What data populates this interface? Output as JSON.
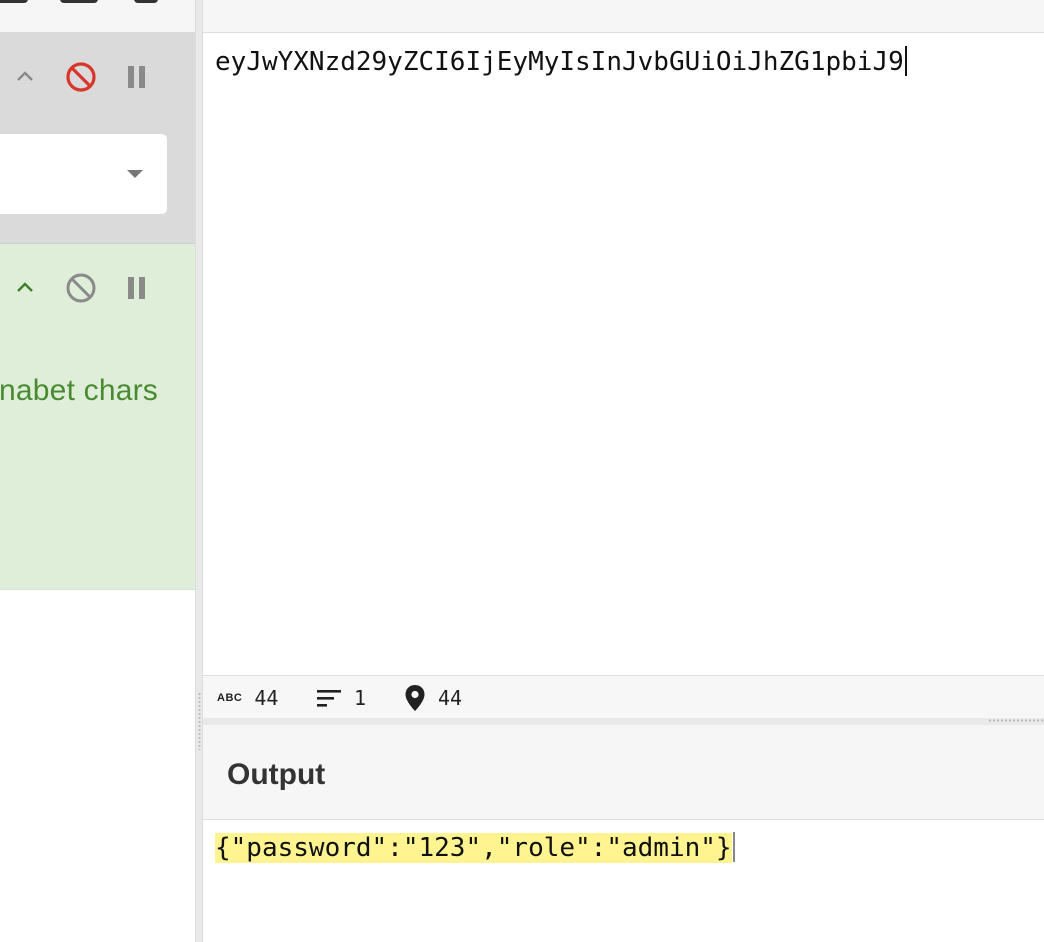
{
  "recipe": {
    "op_disabled": {
      "icons": [
        "chevron-up-icon",
        "disable-icon",
        "pause-icon"
      ],
      "disable_color": "#d9362b"
    },
    "op_active": {
      "icons": [
        "chevron-up-icon",
        "disable-icon",
        "pause-icon"
      ],
      "label_fragment": "nabet chars",
      "accent": "#4a8a32"
    }
  },
  "input": {
    "title": "",
    "value": "eyJwYXNzd29yZCI6IjEyMyIsInJvbGUiOiJhZG1pbiJ9",
    "stats": {
      "length": "44",
      "lines": "1",
      "position": "44"
    }
  },
  "output": {
    "title": "Output",
    "value": "{\"password\":\"123\",\"role\":\"admin\"}",
    "highlight_color": "#fff48f"
  }
}
